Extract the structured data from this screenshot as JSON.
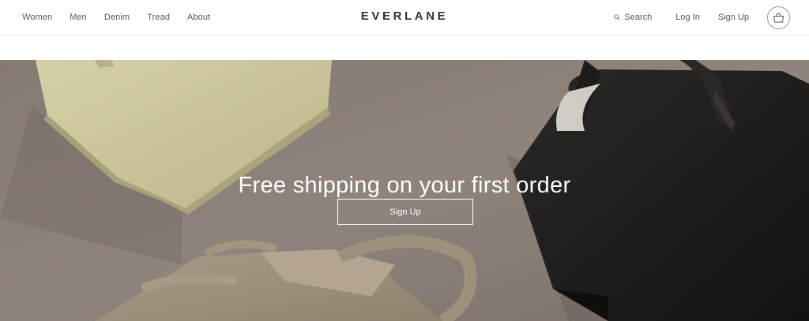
{
  "header": {
    "nav_left": [
      {
        "label": "Women"
      },
      {
        "label": "Men"
      },
      {
        "label": "Denim"
      },
      {
        "label": "Tread"
      },
      {
        "label": "About"
      }
    ],
    "logo": "EVERLANE",
    "search_label": "Search",
    "login_label": "Log In",
    "signup_label": "Sign Up",
    "icons": {
      "search": "search-icon",
      "bag": "shopping-bag-icon"
    }
  },
  "hero": {
    "headline": "Free shipping on your first order",
    "cta_label": "Sign Up"
  },
  "colors": {
    "text_nav": "#555555",
    "logo": "#333333",
    "hero_bg": "#8c8078",
    "hero_text": "#ffffff"
  }
}
